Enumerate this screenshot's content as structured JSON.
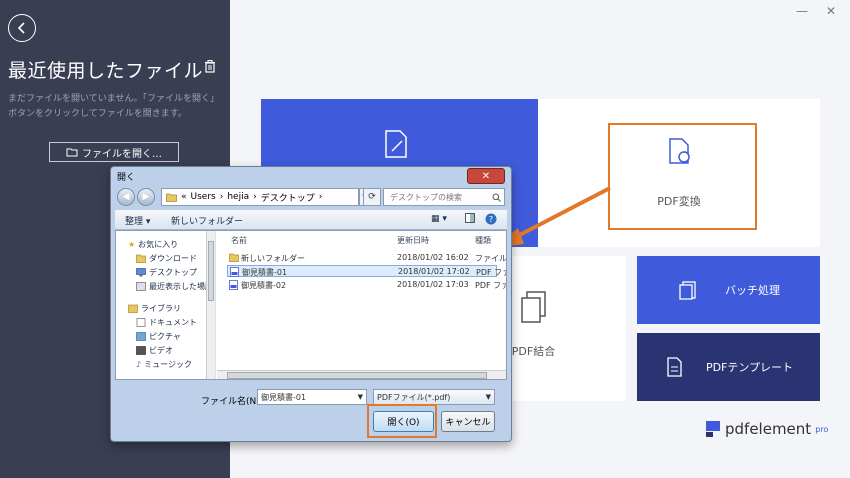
{
  "sidebar": {
    "title": "最近使用したファイル",
    "description": "まだファイルを開いていません。「ファイルを開く」ボタンをクリックしてファイルを開きます。",
    "open_button": "ファイルを開く…"
  },
  "main": {
    "tiles": {
      "pdf_convert": "PDF変換",
      "merge": "PDF結合",
      "batch": "バッチ処理",
      "template": "PDFテンプレート"
    },
    "logo": {
      "brand": "pdfelement",
      "edition": "pro"
    },
    "window_controls": {
      "minimize": "—",
      "close": "✕"
    }
  },
  "dialog": {
    "title": "開く",
    "path": {
      "prefix": "«",
      "segments": [
        "Users",
        "hejia",
        "デスクトップ"
      ]
    },
    "search_placeholder": "デスクトップの検索",
    "toolbar": {
      "organize": "整理 ▾",
      "new_folder": "新しいフォルダー"
    },
    "nav": {
      "favorites": "お気に入り",
      "downloads": "ダウンロード",
      "desktop": "デスクトップ",
      "recent": "最近表示した場所",
      "libraries": "ライブラリ",
      "documents": "ドキュメント",
      "pictures": "ピクチャ",
      "videos": "ビデオ",
      "music": "ミュージック"
    },
    "columns": {
      "name": "名前",
      "modified": "更新日時",
      "type": "種類"
    },
    "files": [
      {
        "name": "新しいフォルダー",
        "modified": "2018/01/02 16:02",
        "type": "ファイル"
      },
      {
        "name": "御見積書-01",
        "modified": "2018/01/02 17:02",
        "type": "PDF ファ"
      },
      {
        "name": "御見積書-02",
        "modified": "2018/01/02 17:03",
        "type": "PDF ファ"
      }
    ],
    "filename_label": "ファイル名(N):",
    "filename_value": "御見積書-01",
    "filetype_value": "PDFファイル(*.pdf)",
    "open_button": "開く(O)",
    "cancel_button": "キャンセル"
  },
  "colors": {
    "accent": "#3f5bdb",
    "dark_tile": "#2b3473",
    "sidebar": "#3a3e52",
    "highlight": "#e1782a"
  }
}
